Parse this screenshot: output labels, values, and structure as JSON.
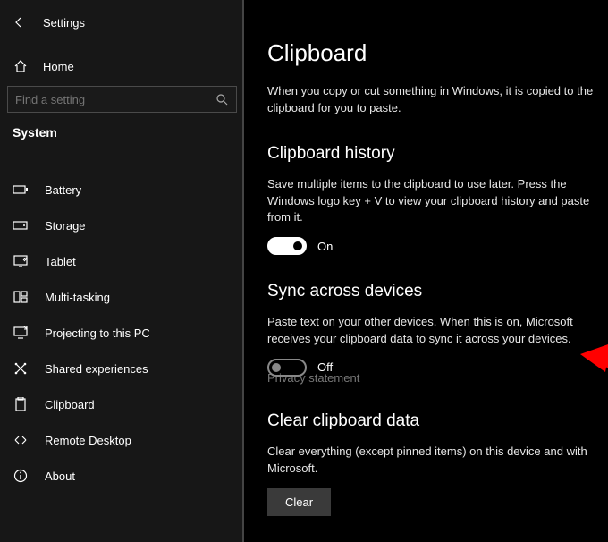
{
  "header": {
    "title": "Settings"
  },
  "home": {
    "label": "Home"
  },
  "search": {
    "placeholder": "Find a setting"
  },
  "category": "System",
  "nav": {
    "items": [
      {
        "label": "Battery"
      },
      {
        "label": "Storage"
      },
      {
        "label": "Tablet"
      },
      {
        "label": "Multi-tasking"
      },
      {
        "label": "Projecting to this PC"
      },
      {
        "label": "Shared experiences"
      },
      {
        "label": "Clipboard"
      },
      {
        "label": "Remote Desktop"
      },
      {
        "label": "About"
      }
    ]
  },
  "main": {
    "title": "Clipboard",
    "intro": "When you copy or cut something in Windows, it is copied to the clipboard for you to paste.",
    "history": {
      "title": "Clipboard history",
      "desc": "Save multiple items to the clipboard to use later. Press the Windows logo key + V to view your clipboard history and paste from it.",
      "toggle_state": "On"
    },
    "sync": {
      "title": "Sync across devices",
      "desc": "Paste text on your other devices. When this is on, Microsoft receives your clipboard data to sync it across your devices.",
      "toggle_state": "Off",
      "privacy_link": "Privacy statement"
    },
    "clear": {
      "title": "Clear clipboard data",
      "desc": "Clear everything (except pinned items) on this device and with Microsoft.",
      "button": "Clear"
    }
  }
}
